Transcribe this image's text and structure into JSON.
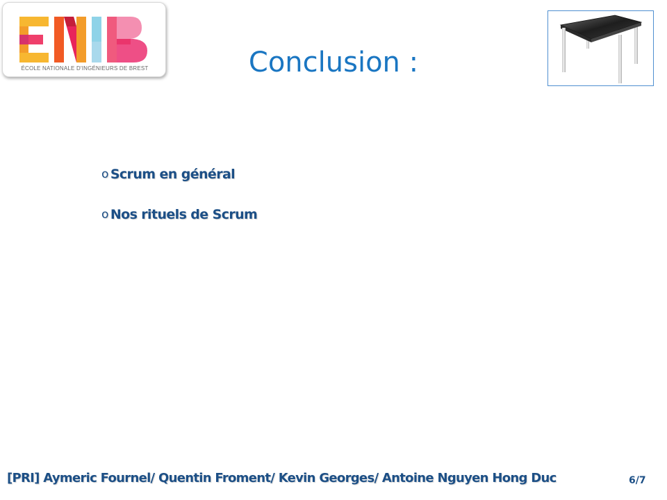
{
  "slide": {
    "title": "Conclusion :",
    "logo": {
      "letters": "ENIB",
      "caption": "ÉCOLE NATIONALE D'INGÉNIEURS DE BREST"
    },
    "bullets": [
      {
        "marker": "o",
        "text": "Scrum en général"
      },
      {
        "marker": "o",
        "text": "Nos rituels de Scrum"
      }
    ],
    "footer": {
      "authors": "[PRI] Aymeric Fournel/ Quentin Froment/ Kevin Georges/ Antoine Nguyen Hong Duc",
      "page": "6/7"
    },
    "image": {
      "icon": "touch-table-icon"
    }
  },
  "colors": {
    "title": "#1a76c2",
    "text": "#1c4f86",
    "frame": "#4f8fd0"
  }
}
